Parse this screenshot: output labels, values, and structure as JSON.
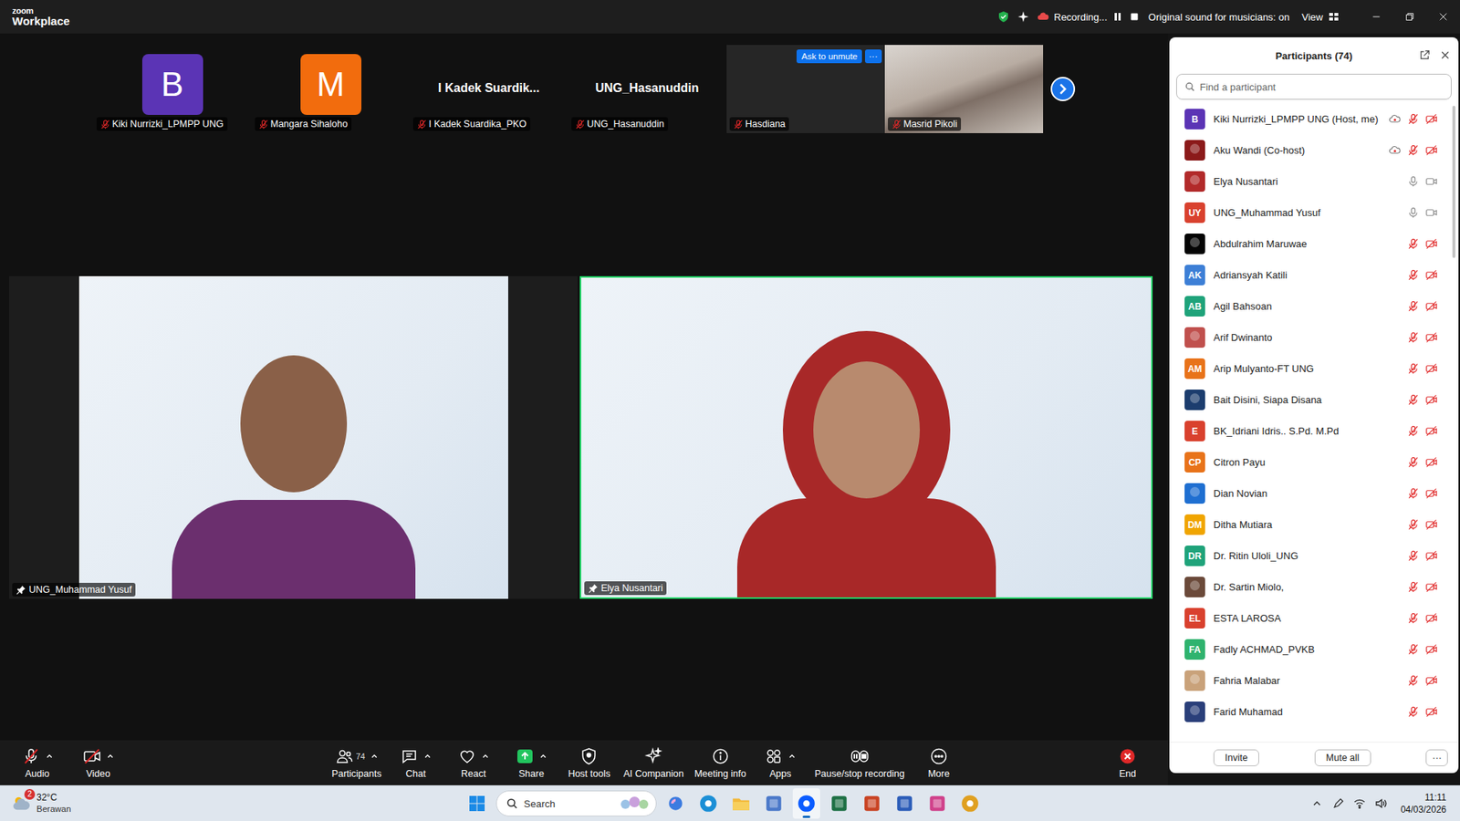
{
  "window": {
    "logo": {
      "top": "zoom",
      "bottom": "Workplace"
    }
  },
  "status_bar": {
    "secure": true,
    "recording_label": "Recording...",
    "original_sound": "Original sound for musicians: on",
    "view": "View"
  },
  "thumbnails": [
    {
      "name": "Kiki Nurrizki_LPMPP UNG",
      "kind": "avatar",
      "initial": "B",
      "color": "#5b34b5",
      "muted": true
    },
    {
      "name": "Mangara Sihaloho",
      "kind": "avatar",
      "initial": "M",
      "color": "#f26c0d",
      "muted": true
    },
    {
      "name": "I Kadek Suardika_PKO",
      "kind": "name",
      "display": "I Kadek Suardik...",
      "muted": true
    },
    {
      "name": "UNG_Hasanuddin",
      "kind": "name",
      "display": "UNG_Hasanuddin",
      "muted": true
    },
    {
      "name": "Hasdiana",
      "kind": "blank",
      "muted": true,
      "hovered": true,
      "hover_button": "Ask to unmute",
      "more": "···"
    },
    {
      "name": "Masrid Pikoli",
      "kind": "video",
      "muted": true,
      "hovered": false
    }
  ],
  "main_videos": [
    {
      "name": "UNG_Muhammad Yusuf",
      "pinned": true,
      "speaking": false
    },
    {
      "name": "Elya Nusantari",
      "pinned": true,
      "speaking": true
    }
  ],
  "toolbar": {
    "left": [
      {
        "label": "Audio",
        "kind": "audio",
        "off": true,
        "caret": true
      },
      {
        "label": "Video",
        "kind": "video",
        "off": true,
        "caret": true
      }
    ],
    "center": [
      {
        "label": "Participants",
        "kind": "participants",
        "count": "74",
        "off": false,
        "caret": true
      },
      {
        "label": "Chat",
        "kind": "chat",
        "off": false,
        "caret": true
      },
      {
        "label": "React",
        "kind": "react",
        "off": false,
        "caret": true
      },
      {
        "label": "Share",
        "kind": "share",
        "off": false,
        "caret": true
      },
      {
        "label": "Host tools",
        "kind": "host",
        "off": false,
        "caret": false
      },
      {
        "label": "AI Companion",
        "kind": "ai",
        "off": false,
        "caret": false
      },
      {
        "label": "Meeting info",
        "kind": "info",
        "off": false,
        "caret": false
      },
      {
        "label": "Apps",
        "kind": "apps",
        "off": false,
        "caret": true
      },
      {
        "label": "Pause/stop recording",
        "kind": "record",
        "off": false,
        "caret": false
      },
      {
        "label": "More",
        "kind": "more",
        "off": false,
        "caret": false
      }
    ],
    "right": [
      {
        "label": "End",
        "kind": "end",
        "off": false,
        "caret": false
      }
    ]
  },
  "participants_panel": {
    "title": "Participants (74)",
    "search_placeholder": "Find a participant",
    "participants": [
      {
        "name": "Kiki Nurrizki_LPMPP UNG (Host, me)",
        "kind": "initials",
        "initials": "B",
        "color": "#5b34b5",
        "recording": true,
        "mic_muted": true,
        "video_off": true
      },
      {
        "name": "Aku Wandi (Co-host)",
        "kind": "photo",
        "color": "#8b1a1a",
        "recording": true,
        "mic_muted": true,
        "video_off": true
      },
      {
        "name": "Elya Nusantari",
        "kind": "photo",
        "color": "#b22a2a",
        "recording": false,
        "mic_muted": false,
        "video_off": false
      },
      {
        "name": "UNG_Muhammad Yusuf",
        "kind": "initials",
        "initials": "UY",
        "color": "#d9412e",
        "recording": false,
        "mic_muted": false,
        "video_off": false
      },
      {
        "name": "Abdulrahim Maruwae",
        "kind": "photo",
        "color": "#050505",
        "recording": false,
        "mic_muted": true,
        "video_off": true
      },
      {
        "name": "Adriansyah Katili",
        "kind": "initials",
        "initials": "AK",
        "color": "#3d7fd6",
        "recording": false,
        "mic_muted": true,
        "video_off": true
      },
      {
        "name": "Agil Bahsoan",
        "kind": "initials",
        "initials": "AB",
        "color": "#1fa37a",
        "recording": false,
        "mic_muted": true,
        "video_off": true
      },
      {
        "name": "Arif Dwinanto",
        "kind": "photo",
        "color": "#c0504d",
        "recording": false,
        "mic_muted": true,
        "video_off": true
      },
      {
        "name": "Arip Mulyanto-FT UNG",
        "kind": "initials",
        "initials": "AM",
        "color": "#e8731a",
        "recording": false,
        "mic_muted": true,
        "video_off": true
      },
      {
        "name": "Bait Disini, Siapa Disana",
        "kind": "photo",
        "color": "#1c3d6e",
        "recording": false,
        "mic_muted": true,
        "video_off": true
      },
      {
        "name": "BK_Idriani Idris.. S.Pd. M.Pd",
        "kind": "initials",
        "initials": "E",
        "color": "#d9412e",
        "recording": false,
        "mic_muted": true,
        "video_off": true
      },
      {
        "name": "Citron Payu",
        "kind": "initials",
        "initials": "CP",
        "color": "#e8731a",
        "recording": false,
        "mic_muted": true,
        "video_off": true
      },
      {
        "name": "Dian Novian",
        "kind": "photo",
        "color": "#1f6fd1",
        "recording": false,
        "mic_muted": true,
        "video_off": true
      },
      {
        "name": "Ditha Mutiara",
        "kind": "initials",
        "initials": "DM",
        "color": "#f0a500",
        "recording": false,
        "mic_muted": true,
        "video_off": true
      },
      {
        "name": "Dr. Ritin Uloli_UNG",
        "kind": "initials",
        "initials": "DR",
        "color": "#1fa37a",
        "recording": false,
        "mic_muted": true,
        "video_off": true
      },
      {
        "name": "Dr. Sartin Miolo,",
        "kind": "photo",
        "color": "#6b4a3a",
        "recording": false,
        "mic_muted": true,
        "video_off": true
      },
      {
        "name": "ESTA LAROSA",
        "kind": "initials",
        "initials": "EL",
        "color": "#d9412e",
        "recording": false,
        "mic_muted": true,
        "video_off": true
      },
      {
        "name": "Fadly ACHMAD_PVKB",
        "kind": "initials",
        "initials": "FA",
        "color": "#2fb36e",
        "recording": false,
        "mic_muted": true,
        "video_off": true
      },
      {
        "name": "Fahria Malabar",
        "kind": "photo",
        "color": "#c9a27a",
        "recording": false,
        "mic_muted": true,
        "video_off": true
      },
      {
        "name": "Farid Muhamad",
        "kind": "photo",
        "color": "#2a3f7a",
        "recording": false,
        "mic_muted": true,
        "video_off": true
      }
    ],
    "buttons": [
      "Invite",
      "Mute all"
    ],
    "more": "···"
  },
  "taskbar": {
    "weather": {
      "temp": "32°C",
      "condition": "Berawan",
      "badge": "2"
    },
    "search": "Search",
    "apps": [
      {
        "kind": "copilot",
        "color": "#3b7be0",
        "active": false
      },
      {
        "kind": "edge",
        "color": "#1b8fd6",
        "active": false
      },
      {
        "kind": "explorer",
        "color": "#f2b93b",
        "active": false
      },
      {
        "kind": "app",
        "color": "#4a78c9",
        "active": false
      },
      {
        "kind": "zoom",
        "color": "#0b5cff",
        "active": true
      },
      {
        "kind": "excel",
        "color": "#1d7044",
        "active": false
      },
      {
        "kind": "powerpoint",
        "color": "#c94323",
        "active": false
      },
      {
        "kind": "word",
        "color": "#2b5cb8",
        "active": false
      },
      {
        "kind": "snip",
        "color": "#d0418a",
        "active": false
      },
      {
        "kind": "chrome",
        "color": "#e0a020",
        "active": false
      }
    ],
    "time": "11:11",
    "date": "04/03/2026"
  }
}
